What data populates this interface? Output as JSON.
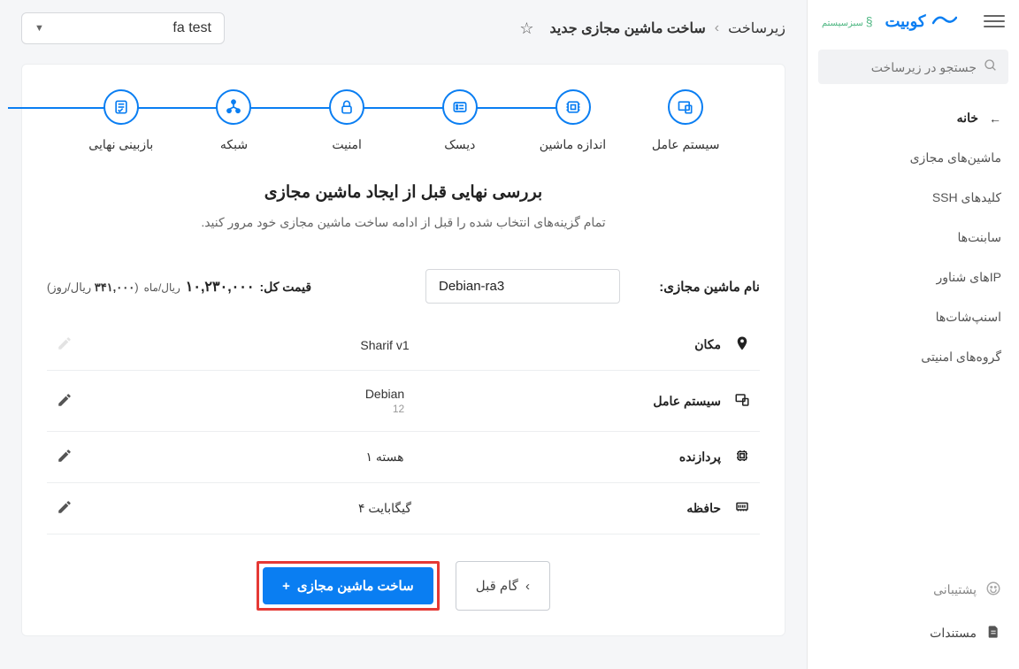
{
  "header": {
    "logo_text": "کوبیت",
    "logo_sub": "سبزسیستم"
  },
  "search": {
    "placeholder": "جستجو در زیرساخت"
  },
  "sidebar": {
    "items": [
      {
        "label": "خانه"
      },
      {
        "label": "ماشین‌های مجازی"
      },
      {
        "label": "کلیدهای SSH"
      },
      {
        "label": "سابنت‌ها"
      },
      {
        "label": "IPهای شناور"
      },
      {
        "label": "اسنپ‌شات‌ها"
      },
      {
        "label": "گروه‌های امنیتی"
      }
    ],
    "bottom": {
      "support": "پشتیبانی",
      "docs": "مستندات"
    }
  },
  "breadcrumbs": {
    "root": "زیرساخت",
    "current": "ساخت ماشین مجازی جدید"
  },
  "project_select": "fa test",
  "stepper": [
    {
      "label": "سیستم عامل"
    },
    {
      "label": "اندازه ماشین"
    },
    {
      "label": "دیسک"
    },
    {
      "label": "امنیت"
    },
    {
      "label": "شبکه"
    },
    {
      "label": "بازبینی نهایی"
    }
  ],
  "review": {
    "heading": "بررسی نهایی قبل از ایجاد ماشین مجازی",
    "subtitle": "تمام گزینه‌های انتخاب شده را قبل از ادامه ساخت ماشین مجازی خود مرور کنید."
  },
  "vm_name": {
    "label": "نام ماشین مجازی:",
    "value": "Debian-ra3"
  },
  "price": {
    "label": "قیمت کل:",
    "monthly_value": "۱۰,۲۳۰,۰۰۰",
    "monthly_unit": "ریال/ماه",
    "daily_value": "۳۴۱,۰۰۰",
    "daily_unit": "ریال/روز"
  },
  "summary": [
    {
      "icon": "location",
      "label": "مکان",
      "value": "Sharif v1",
      "sub": "",
      "editable": false
    },
    {
      "icon": "os",
      "label": "سیستم عامل",
      "value": "Debian",
      "sub": "12",
      "editable": true
    },
    {
      "icon": "cpu",
      "label": "پردازنده",
      "value": "۱ هسته",
      "sub": "",
      "editable": true
    },
    {
      "icon": "memory",
      "label": "حافظه",
      "value": "۴ گیگابایت",
      "sub": "",
      "editable": true
    }
  ],
  "actions": {
    "prev": "گام قبل",
    "create": "ساخت ماشین مجازی"
  }
}
